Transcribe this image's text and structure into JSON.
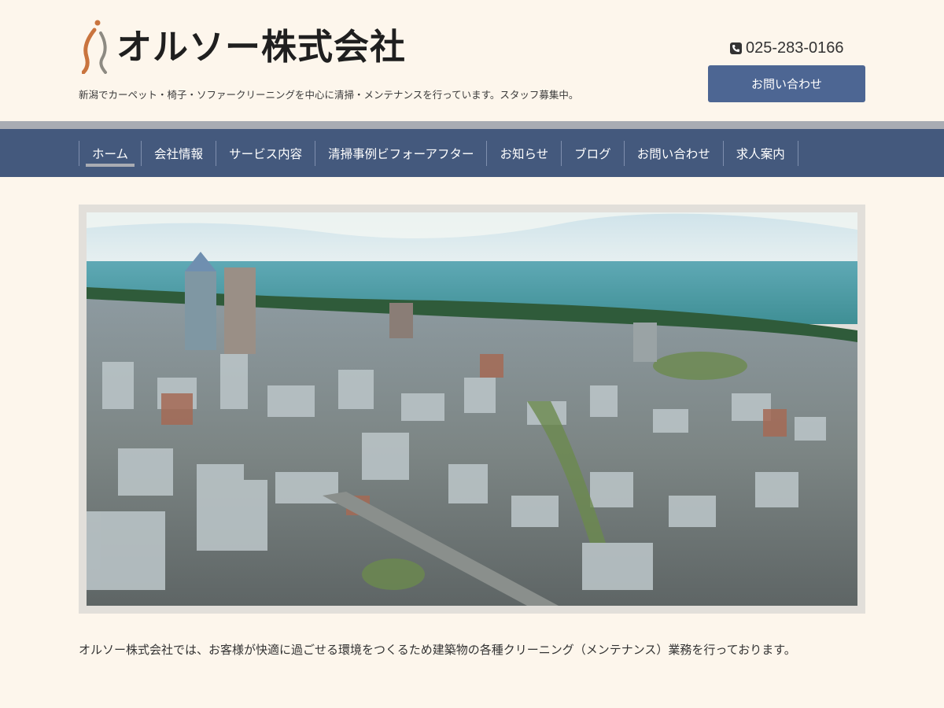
{
  "header": {
    "logo_text": "オルソー株式会社",
    "tagline": "新潟でカーペット・椅子・ソファークリーニングを中心に清掃・メンテナンスを行っています。スタッフ募集中。",
    "phone": "025-283-0166",
    "contact_button": "お問い合わせ"
  },
  "nav": {
    "items": [
      {
        "label": "ホーム"
      },
      {
        "label": "会社情報"
      },
      {
        "label": "サービス内容"
      },
      {
        "label": "清掃事例ビフォーアフター"
      },
      {
        "label": "お知らせ"
      },
      {
        "label": "ブログ"
      },
      {
        "label": "お問い合わせ"
      },
      {
        "label": "求人案内"
      }
    ],
    "active_index": 0
  },
  "main": {
    "intro_text": "オルソー株式会社では、お客様が快適に過ごせる環境をつくるため建築物の各種クリーニング（メンテナンス）業務を行っております。"
  },
  "colors": {
    "background": "#fdf6ec",
    "nav": "#44597d",
    "button": "#4d6693",
    "nav_border": "#a9acb3"
  }
}
